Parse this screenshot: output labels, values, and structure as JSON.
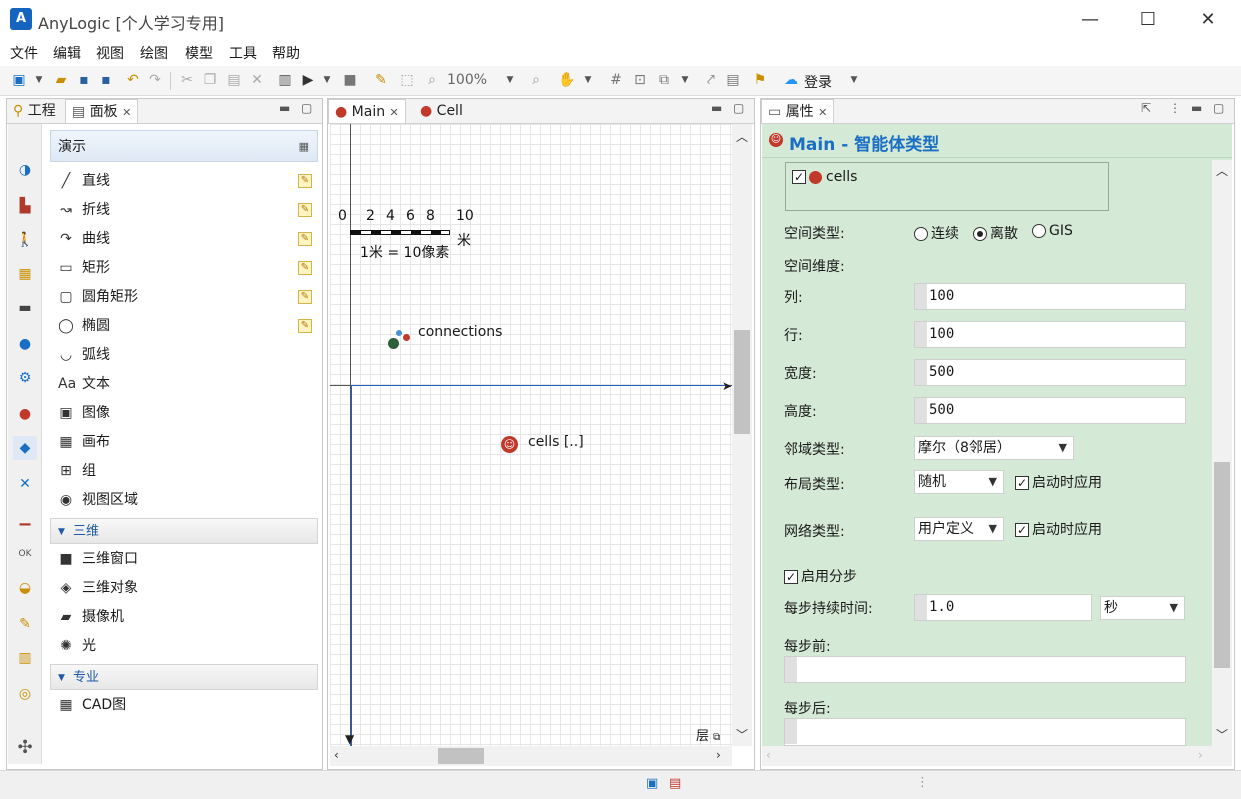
{
  "app": {
    "title": "AnyLogic [个人学习专用]",
    "logo": "A"
  },
  "window": {
    "minimize": "—",
    "maximize": "☐",
    "close": "✕"
  },
  "menu": [
    "文件",
    "编辑",
    "视图",
    "绘图",
    "模型",
    "工具",
    "帮助"
  ],
  "toolbar": {
    "zoom": "100%",
    "login": "登录"
  },
  "left_panel": {
    "tabs": [
      {
        "label": "工程"
      },
      {
        "label": "面板"
      }
    ],
    "palette_title": "演示",
    "items": [
      {
        "label": "直线",
        "icon": "line-icon",
        "glyph": "╱"
      },
      {
        "label": "折线",
        "icon": "polyline-icon",
        "glyph": "↝"
      },
      {
        "label": "曲线",
        "icon": "curve-icon",
        "glyph": "↷"
      },
      {
        "label": "矩形",
        "icon": "rectangle-icon",
        "glyph": "▭"
      },
      {
        "label": "圆角矩形",
        "icon": "rounded-rectangle-icon",
        "glyph": "▢"
      },
      {
        "label": "椭圆",
        "icon": "oval-icon",
        "glyph": "◯"
      },
      {
        "label": "弧线",
        "icon": "arc-icon",
        "glyph": "◡"
      },
      {
        "label": "文本",
        "icon": "text-icon",
        "glyph": "Aa"
      },
      {
        "label": "图像",
        "icon": "image-icon",
        "glyph": "▣"
      },
      {
        "label": "画布",
        "icon": "canvas-icon",
        "glyph": "▦"
      },
      {
        "label": "组",
        "icon": "group-icon",
        "glyph": "⊞"
      },
      {
        "label": "视图区域",
        "icon": "view-area-icon",
        "glyph": "◉"
      }
    ],
    "section_3d": "三维",
    "items_3d": [
      {
        "label": "三维窗口",
        "icon": "3d-window-icon",
        "glyph": "■"
      },
      {
        "label": "三维对象",
        "icon": "3d-object-icon",
        "glyph": "◈"
      },
      {
        "label": "摄像机",
        "icon": "camera-icon",
        "glyph": "▰"
      },
      {
        "label": "光",
        "icon": "light-icon",
        "glyph": "✺"
      }
    ],
    "section_pro": "专业",
    "items_pro": [
      {
        "label": "CAD图",
        "icon": "cad-icon",
        "glyph": "▦"
      }
    ]
  },
  "editor": {
    "tabs": [
      {
        "label": "Main"
      },
      {
        "label": "Cell"
      }
    ],
    "scale_ticks": [
      "0",
      "2",
      "4",
      "6",
      "8",
      "10"
    ],
    "scale_unit": "米",
    "scale_text": "1米 = 10像素",
    "connections_label": "connections",
    "cells_label": "cells [..]",
    "layers_label": "层"
  },
  "properties": {
    "tab": "属性",
    "header": "Main - 智能体类型",
    "agent_checkbox": "cells",
    "space_type_label": "空间类型:",
    "space_options": [
      "连续",
      "离散",
      "GIS"
    ],
    "space_selected": 1,
    "space_dim_label": "空间维度:",
    "cols_label": "列:",
    "cols_value": "100",
    "rows_label": "行:",
    "rows_value": "100",
    "width_label": "宽度:",
    "width_value": "500",
    "height_label": "高度:",
    "height_value": "500",
    "neighborhood_label": "邻域类型:",
    "neighborhood_value": "摩尔（8邻居）",
    "layout_label": "布局类型:",
    "layout_value": "随机",
    "layout_apply": "启动时应用",
    "network_label": "网络类型:",
    "network_value": "用户定义",
    "network_apply": "启动时应用",
    "enable_steps": "启用分步",
    "step_duration_label": "每步持续时间:",
    "step_duration_value": "1.0",
    "step_unit": "秒",
    "before_step_label": "每步前:",
    "after_step_label": "每步后:"
  },
  "colors": {
    "accent": "#1a6fc4",
    "props_bg": "#d5ead6",
    "agent_red": "#c0392b"
  }
}
